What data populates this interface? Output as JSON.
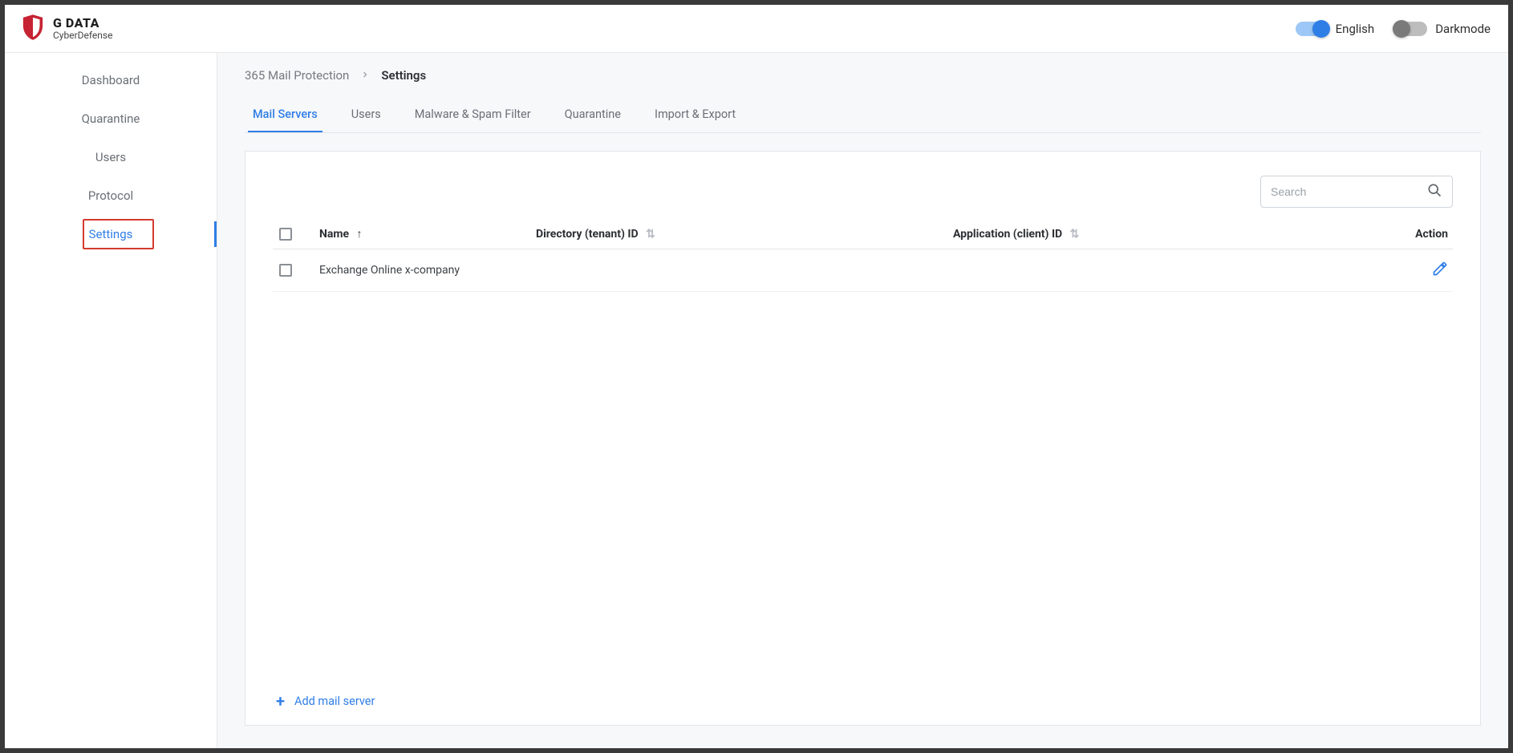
{
  "brand": {
    "title": "G DATA",
    "sub": "CyberDefense"
  },
  "header": {
    "lang_label": "English",
    "dark_label": "Darkmode"
  },
  "sidebar": {
    "items": [
      {
        "label": "Dashboard"
      },
      {
        "label": "Quarantine"
      },
      {
        "label": "Users"
      },
      {
        "label": "Protocol"
      },
      {
        "label": "Settings"
      }
    ]
  },
  "breadcrumb": {
    "parent": "365 Mail Protection",
    "current": "Settings"
  },
  "tabs": [
    {
      "label": "Mail Servers"
    },
    {
      "label": "Users"
    },
    {
      "label": "Malware & Spam Filter"
    },
    {
      "label": "Quarantine"
    },
    {
      "label": "Import & Export"
    }
  ],
  "search": {
    "placeholder": "Search"
  },
  "columns": {
    "name": "Name",
    "directory": "Directory (tenant) ID",
    "application": "Application (client) ID",
    "action": "Action"
  },
  "rows": [
    {
      "name": "Exchange Online x-company",
      "directory": "",
      "application": ""
    }
  ],
  "add_label": "Add mail server"
}
